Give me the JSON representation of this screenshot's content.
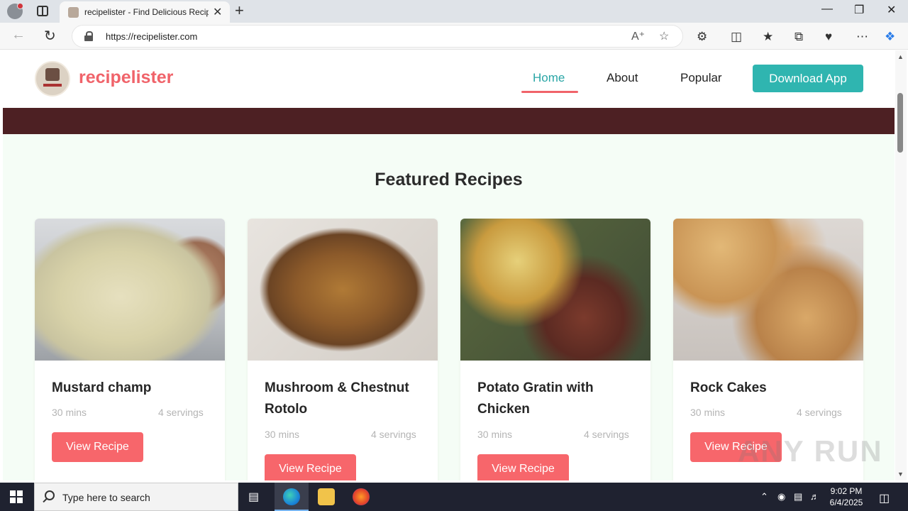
{
  "browser": {
    "tab_title": "recipelister - Find Delicious Recip",
    "url": "https://recipelister.com",
    "new_tab": "+",
    "tab_close": "✕"
  },
  "site": {
    "brand": "recipelister",
    "nav": [
      {
        "label": "Home",
        "active": true
      },
      {
        "label": "About",
        "active": false
      },
      {
        "label": "Popular",
        "active": false
      }
    ],
    "cta": "Download App",
    "section_title": "Featured Recipes",
    "recipes": [
      {
        "title": "Mustard champ",
        "time": "30 mins",
        "servings": "4 servings",
        "button": "View Recipe"
      },
      {
        "title": "Mushroom & Chestnut Rotolo",
        "time": "30 mins",
        "servings": "4 servings",
        "button": "View Recipe"
      },
      {
        "title": "Potato Gratin with Chicken",
        "time": "30 mins",
        "servings": "4 servings",
        "button": "View Recipe"
      },
      {
        "title": "Rock Cakes",
        "time": "30 mins",
        "servings": "4 servings",
        "button": "View Recipe"
      }
    ],
    "colors": {
      "brand": "#f0636a",
      "accent": "#2fb5b0",
      "band": "#4d2023"
    }
  },
  "taskbar": {
    "search_placeholder": "Type here to search",
    "time": "9:02 PM",
    "date": "6/4/2025"
  },
  "watermark": "ANY RUN"
}
